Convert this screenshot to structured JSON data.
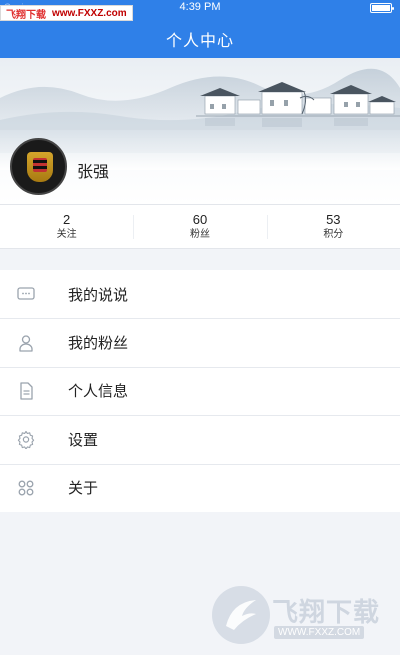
{
  "status_bar": {
    "carrier": "Carrier",
    "time": "4:39 PM",
    "battery_level": 1.0
  },
  "watermark_top": {
    "brand": "飞翔下载",
    "url": "www.FXXZ.com"
  },
  "header": {
    "title": "个人中心"
  },
  "profile": {
    "name": "张强"
  },
  "stats": [
    {
      "value": "2",
      "label": "关注"
    },
    {
      "value": "60",
      "label": "粉丝"
    },
    {
      "value": "53",
      "label": "积分"
    }
  ],
  "menu": [
    {
      "label": "我的说说",
      "icon": "chat-bubble-icon"
    },
    {
      "label": "我的粉丝",
      "icon": "person-icon"
    },
    {
      "label": "个人信息",
      "icon": "document-icon"
    },
    {
      "label": "设置",
      "icon": "gear-icon"
    },
    {
      "label": "关于",
      "icon": "grid-icon"
    }
  ],
  "watermark_bottom": {
    "brand": "飞翔下载",
    "url": "WWW.FXXZ.COM"
  },
  "colors": {
    "header_bg": "#2f80e8",
    "page_bg": "#f2f4f8",
    "icon_gray": "#9aa3ad"
  }
}
